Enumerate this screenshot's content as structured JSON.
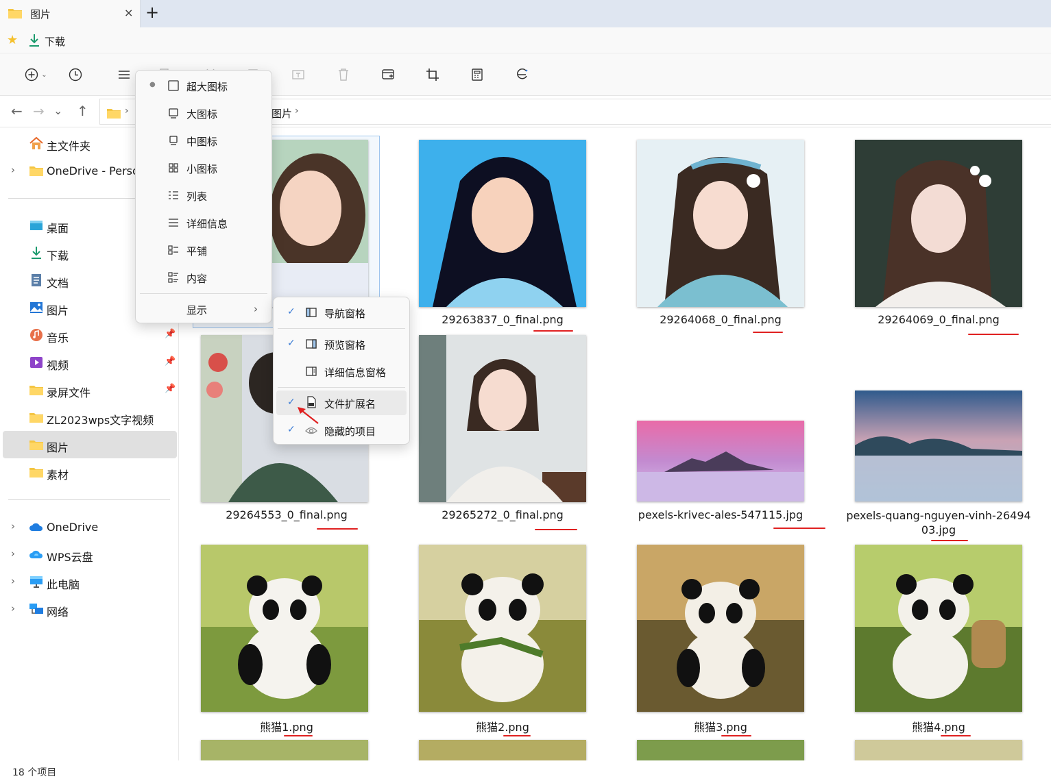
{
  "window": {
    "tab_title": "图片",
    "new_tab_symbol": "+",
    "close_symbol": "×"
  },
  "favorites": {
    "items": [
      {
        "label": "下载",
        "icon": "download-icon"
      }
    ]
  },
  "toolbar": {
    "buttons": [
      "new-icon",
      "recent-icon",
      "view-icon",
      "copy-icon",
      "cut-icon",
      "paste-icon",
      "rename-icon",
      "delete-icon",
      "screen-icon",
      "crop-icon",
      "calculator-icon",
      "browser-icon"
    ]
  },
  "address": {
    "current": "图片",
    "separator": "›"
  },
  "sidebar": {
    "top": [
      {
        "label": "主文件夹",
        "icon": "home-icon"
      },
      {
        "label": "OneDrive - Perso",
        "icon": "folder-icon"
      }
    ],
    "quick": [
      {
        "label": "桌面",
        "icon": "desktop-icon",
        "pinned": false
      },
      {
        "label": "下载",
        "icon": "download-icon",
        "pinned": false
      },
      {
        "label": "文档",
        "icon": "document-icon",
        "pinned": false
      },
      {
        "label": "图片",
        "icon": "picture-icon",
        "pinned": false
      },
      {
        "label": "音乐",
        "icon": "music-icon",
        "pinned": true
      },
      {
        "label": "视频",
        "icon": "video-icon",
        "pinned": true
      },
      {
        "label": "录屏文件",
        "icon": "folder-icon",
        "pinned": true
      },
      {
        "label": "ZL2023wps文字视频",
        "icon": "folder-icon",
        "pinned": false
      },
      {
        "label": "图片",
        "icon": "folder-icon",
        "pinned": false,
        "selected": true
      },
      {
        "label": "素材",
        "icon": "folder-icon",
        "pinned": false
      }
    ],
    "locations": [
      {
        "label": "OneDrive",
        "icon": "cloud-icon"
      },
      {
        "label": "WPS云盘",
        "icon": "cloud-icon"
      },
      {
        "label": "此电脑",
        "icon": "computer-icon"
      },
      {
        "label": "网络",
        "icon": "network-icon"
      }
    ]
  },
  "files": [
    {
      "name": "29263837_0_final.png"
    },
    {
      "name": "29264068_0_final.png"
    },
    {
      "name": "29264069_0_final.png"
    },
    {
      "name": "29264553_0_final.png"
    },
    {
      "name": "29265272_0_final.png"
    },
    {
      "name": "pexels-krivec-ales-547115.jpg"
    },
    {
      "name": "pexels-quang-nguyen-vinh-2649403.jpg",
      "line1": "pexels-quang-nguyen-vinh-26494",
      "line2": "03.jpg"
    },
    {
      "name": "熊猫1.png"
    },
    {
      "name": "熊猫2.png"
    },
    {
      "name": "熊猫3.png"
    },
    {
      "name": "熊猫4.png"
    }
  ],
  "status": {
    "item_count": "18 个项目"
  },
  "view_menu": {
    "items": [
      {
        "label": "超大图标",
        "icon": "extra-large-icons-icon",
        "selected": true
      },
      {
        "label": "大图标",
        "icon": "large-icons-icon"
      },
      {
        "label": "中图标",
        "icon": "medium-icons-icon"
      },
      {
        "label": "小图标",
        "icon": "small-icons-icon"
      },
      {
        "label": "列表",
        "icon": "list-icon"
      },
      {
        "label": "详细信息",
        "icon": "details-icon"
      },
      {
        "label": "平铺",
        "icon": "tiles-icon"
      },
      {
        "label": "内容",
        "icon": "content-icon"
      }
    ],
    "show_label": "显示",
    "show_arrow": "›"
  },
  "show_submenu": {
    "items": [
      {
        "label": "导航窗格",
        "checked": true,
        "icon": "nav-pane-icon"
      },
      {
        "label": "预览窗格",
        "checked": true,
        "icon": "preview-pane-icon"
      },
      {
        "label": "详细信息窗格",
        "checked": false,
        "icon": "details-pane-icon"
      },
      {
        "label": "文件扩展名",
        "checked": true,
        "icon": "file-extension-icon",
        "hover": true
      },
      {
        "label": "隐藏的项目",
        "checked": true,
        "icon": "hidden-items-icon"
      }
    ],
    "check_symbol": "✓"
  },
  "colors": {
    "annotation_red": "#e02020",
    "folder_yellow": "#f4c542",
    "accent_blue": "#3a7bd5"
  }
}
